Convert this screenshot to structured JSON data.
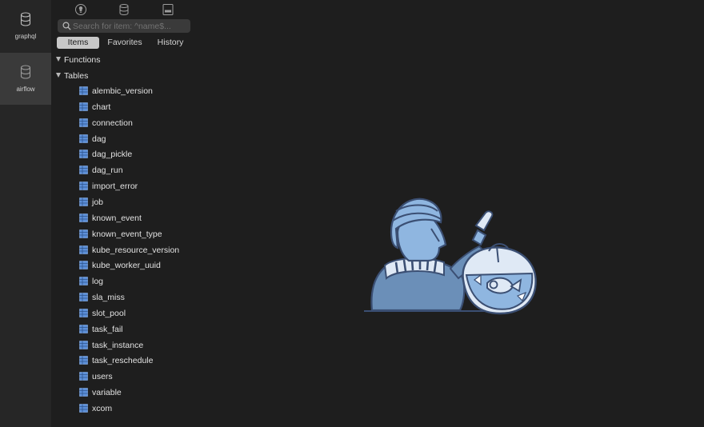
{
  "connections": [
    {
      "name": "graphql",
      "active": false
    },
    {
      "name": "airflow",
      "active": true
    }
  ],
  "toolbar": {
    "icons": [
      "bulb-icon",
      "database-icon",
      "sql-editor-icon"
    ]
  },
  "search": {
    "placeholder": "Search for item: ^name$...",
    "value": ""
  },
  "tabs": [
    {
      "label": "Items",
      "active": true
    },
    {
      "label": "Favorites",
      "active": false
    },
    {
      "label": "History",
      "active": false
    }
  ],
  "tree": {
    "functions_label": "Functions",
    "tables_label": "Tables",
    "tables": [
      "alembic_version",
      "chart",
      "connection",
      "dag",
      "dag_pickle",
      "dag_run",
      "import_error",
      "job",
      "known_event",
      "known_event_type",
      "kube_resource_version",
      "kube_worker_uuid",
      "log",
      "sla_miss",
      "slot_pool",
      "task_fail",
      "task_instance",
      "task_reschedule",
      "users",
      "variable",
      "xcom"
    ]
  },
  "colors": {
    "rail_bg": "#262626",
    "rail_active": "#3a3a3a",
    "table_icon": "#5c8fd8",
    "illustration_fill": "#8fb6e0",
    "illustration_stroke": "#3b4f73"
  }
}
